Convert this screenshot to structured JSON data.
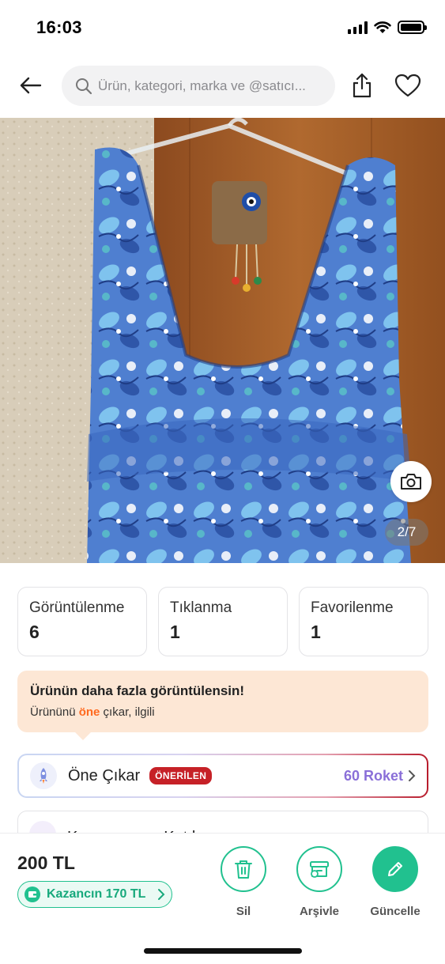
{
  "status_bar": {
    "time": "16:03"
  },
  "header": {
    "search_placeholder": "Ürün, kategori, marka ve @satıcı...",
    "icons": [
      "back-arrow-icon",
      "search-icon",
      "share-icon",
      "heart-icon"
    ]
  },
  "gallery": {
    "counter": "2/7",
    "icons": [
      "camera-icon"
    ]
  },
  "stats": [
    {
      "label": "Görüntülenme",
      "value": "6"
    },
    {
      "label": "Tıklanma",
      "value": "1"
    },
    {
      "label": "Favorilenme",
      "value": "1"
    }
  ],
  "promo": {
    "title": "Ürünün daha fazla görüntülensin!",
    "text_before": "Ürününü ",
    "text_highlight": "öne",
    "text_after": " çıkar, ilgili"
  },
  "feature": {
    "label": "Öne Çıkar",
    "badge": "ÖNERİLEN",
    "price": "60 Roket"
  },
  "campaign": {
    "label": "Kampanyaya Katıl"
  },
  "bottom": {
    "price": "200 TL",
    "earn": "Kazancın 170 TL",
    "actions": {
      "delete": "Sil",
      "archive": "Arşivle",
      "update": "Güncelle"
    }
  },
  "colors": {
    "accent_green": "#21c18f",
    "promo_bg": "#fde7d5",
    "highlight_orange": "#ff6a1f",
    "badge_red": "#c62127",
    "roket_purple": "#8a6fd8"
  }
}
